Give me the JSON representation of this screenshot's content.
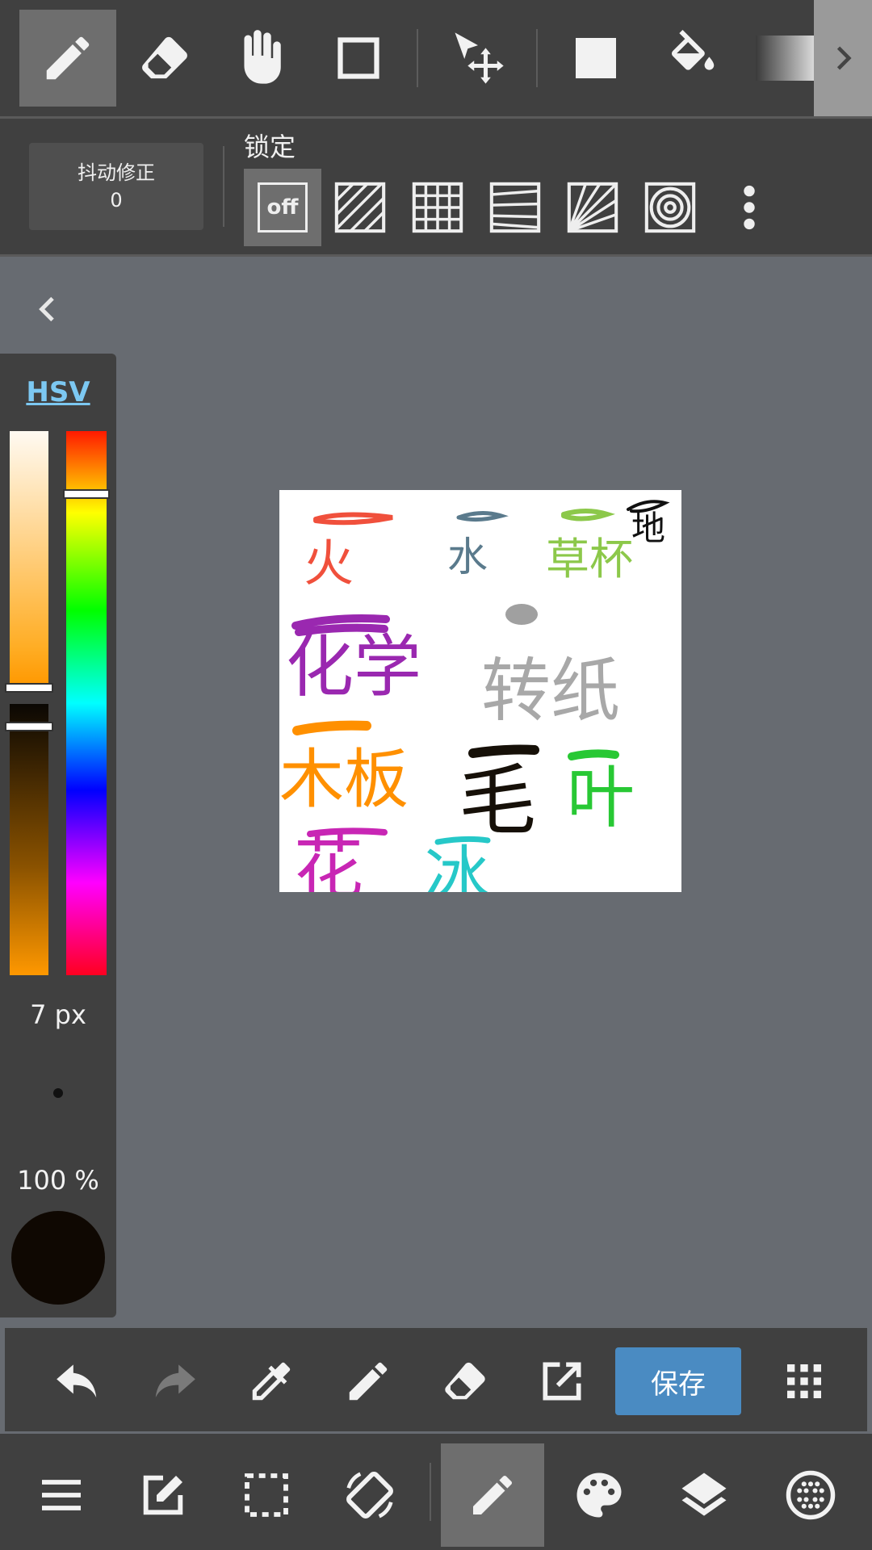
{
  "top_tools": [
    {
      "name": "pen-icon",
      "active": true
    },
    {
      "name": "eraser-icon",
      "active": false
    },
    {
      "name": "hand-icon",
      "active": false
    },
    {
      "name": "rectangle-outline-icon",
      "active": false
    },
    {
      "name": "move-select-icon",
      "active": false
    },
    {
      "name": "filled-rectangle-icon",
      "active": false
    },
    {
      "name": "paint-bucket-icon",
      "active": false
    },
    {
      "name": "gradient-icon",
      "active": false
    }
  ],
  "stabilizer": {
    "label": "抖动修正",
    "value": "0"
  },
  "lock": {
    "title": "锁定",
    "off_label": "off",
    "options": [
      "off-icon",
      "parallel-lines-icon",
      "grid-icon",
      "perspective-lines-icon",
      "radial-lines-icon",
      "concentric-circles-icon"
    ]
  },
  "color_panel": {
    "mode": "HSV",
    "brush_size": "7 px",
    "opacity": "100 %",
    "current_color": "#0f0802",
    "hue_color": "#ff9800"
  },
  "drawing_words": [
    {
      "text": "火",
      "color": "#f0503c"
    },
    {
      "text": "水",
      "color": "#5a7a8c"
    },
    {
      "text": "草杯",
      "color": "#8cc84a"
    },
    {
      "text": "地",
      "color": "#111111"
    },
    {
      "text": "化学",
      "color": "#9a28b0"
    },
    {
      "text": "转纸",
      "color": "#a8a8a8"
    },
    {
      "text": "木板",
      "color": "#ff9000"
    },
    {
      "text": "毛",
      "color": "#161008"
    },
    {
      "text": "叶",
      "color": "#28c834"
    },
    {
      "text": "花",
      "color": "#c826b4"
    },
    {
      "text": "冰",
      "color": "#26c8c8"
    }
  ],
  "toolbar2": {
    "save_label": "保存",
    "icons": [
      "undo-icon",
      "redo-icon",
      "eyedropper-icon",
      "pen-icon",
      "eraser-icon",
      "export-icon",
      "grid-dots-icon"
    ]
  },
  "bottom_nav": [
    "menu-icon",
    "edit-icon",
    "selection-icon",
    "rotate-icon",
    "brush-icon",
    "palette-icon",
    "layers-icon",
    "material-icon"
  ]
}
